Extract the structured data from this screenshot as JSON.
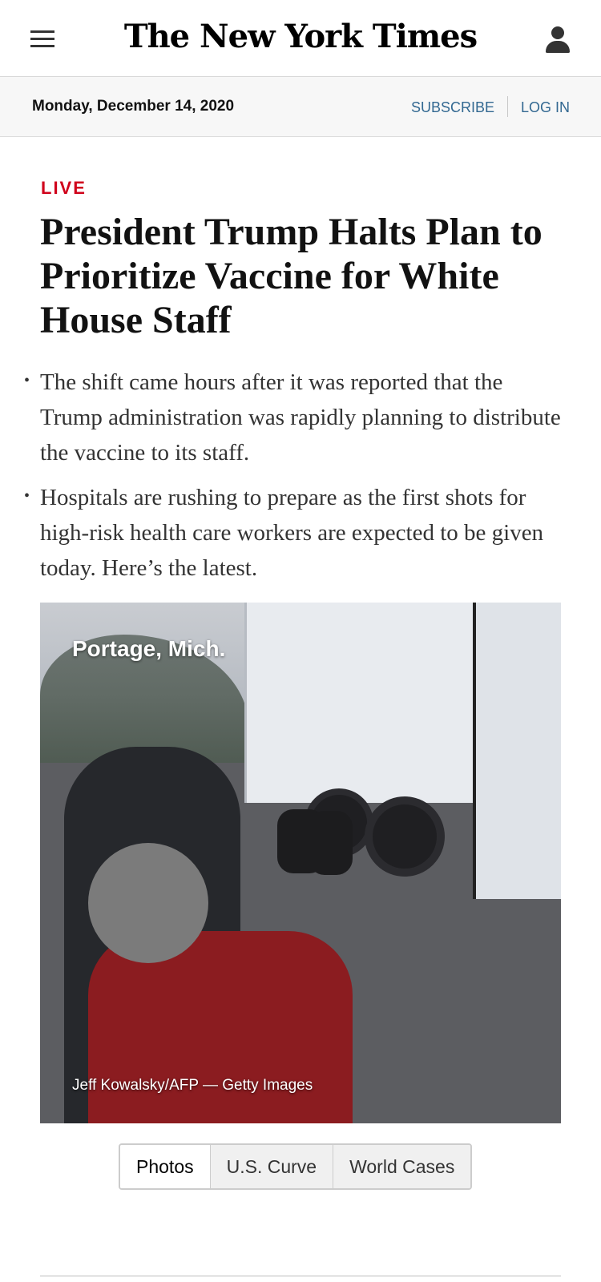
{
  "header": {
    "logo": "The New York Times",
    "menu_icon": "hamburger-icon",
    "account_icon": "user-icon"
  },
  "datebar": {
    "date": "Monday, December 14, 2020",
    "subscribe": "SUBSCRIBE",
    "login": "LOG IN"
  },
  "article": {
    "kicker": "LIVE",
    "headline": "President Trump Halts Plan to Prioritize Vaccine for White House Staff",
    "summary": [
      "The shift came hours after it was reported that the Trump administration was rapidly planning to distribute the vaccine to its staff.",
      "Hospitals are rushing to prepare as the first shots for high-risk health care workers are expected to be given today. Here’s the latest."
    ],
    "photo": {
      "location": "Portage, Mich.",
      "credit": "Jeff Kowalsky/AFP — Getty Images"
    }
  },
  "tabs": [
    {
      "label": "Photos",
      "active": true
    },
    {
      "label": "U.S. Curve",
      "active": false
    },
    {
      "label": "World Cases",
      "active": false
    }
  ],
  "colors": {
    "live": "#d0021b",
    "link": "#326891"
  }
}
